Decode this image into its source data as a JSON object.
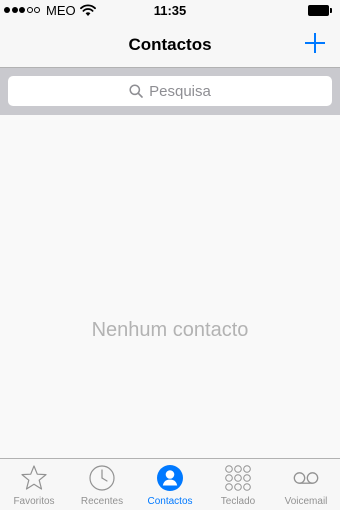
{
  "status_bar": {
    "carrier": "MEO",
    "time": "11:35",
    "signal_bars_filled": 3,
    "signal_bars_total": 5,
    "wifi_icon": "wifi-icon",
    "battery_icon": "battery-full-icon"
  },
  "nav": {
    "title": "Contactos",
    "add_icon": "plus-icon"
  },
  "search": {
    "placeholder": "Pesquisa"
  },
  "content": {
    "empty_message": "Nenhum contacto"
  },
  "tab_bar": {
    "items": [
      {
        "label": "Favoritos",
        "icon": "star-icon",
        "active": false
      },
      {
        "label": "Recentes",
        "icon": "clock-icon",
        "active": false
      },
      {
        "label": "Contactos",
        "icon": "person-icon",
        "active": true
      },
      {
        "label": "Teclado",
        "icon": "keypad-icon",
        "active": false
      },
      {
        "label": "Voicemail",
        "icon": "voicemail-icon",
        "active": false
      }
    ]
  },
  "colors": {
    "accent": "#0079ff",
    "inactive": "#929292",
    "bar_background": "#f7f7f7",
    "search_background": "#c9c9ce",
    "empty_text": "#b3b3b3"
  }
}
